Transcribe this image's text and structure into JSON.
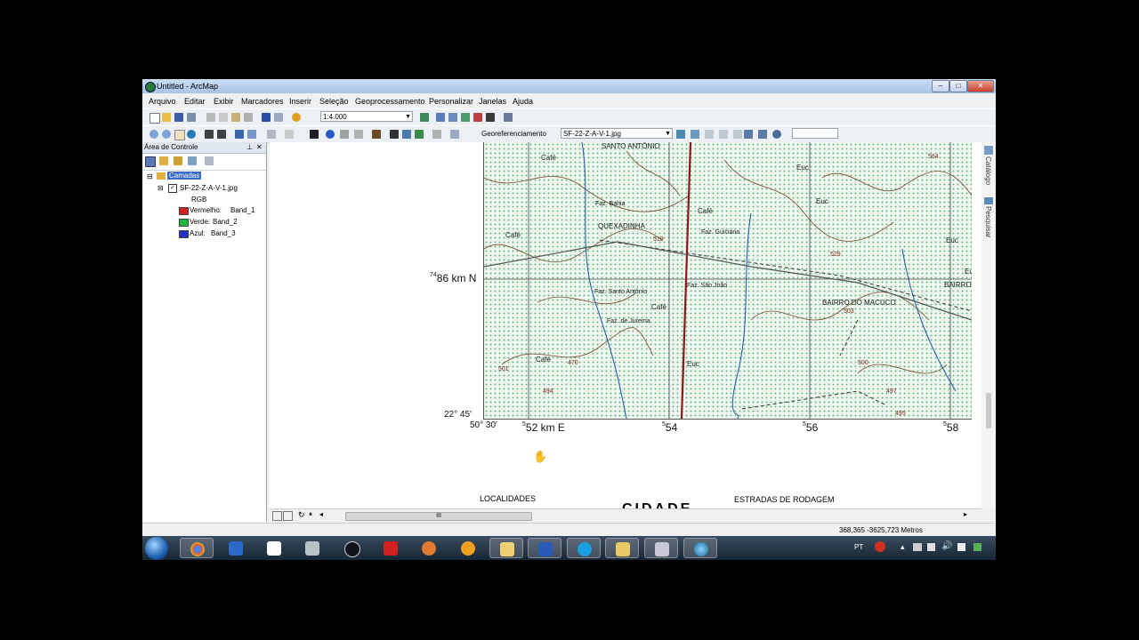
{
  "window": {
    "title": "Untitled - ArcMap",
    "minimize": "–",
    "maximize": "□",
    "close": "✕"
  },
  "menu": [
    "Arquivo",
    "Editar",
    "Exibir",
    "Marcadores",
    "Inserir",
    "Seleção",
    "Geoprocessamento",
    "Personalizar",
    "Janelas",
    "Ajuda"
  ],
  "toolbar": {
    "scale": "1:4.000",
    "georef_label": "Georeferenciamento",
    "georef_layer": "SF-22-Z-A-V-1.jpg"
  },
  "toc": {
    "title": "Área de Controle",
    "pin": "⊥",
    "close": "✕",
    "root": "Camadas",
    "layer": "SF-22-Z-A-V-1.jpg",
    "rgb": "RGB",
    "bands": [
      {
        "label": "Vermelho:",
        "band": "Band_1",
        "color": "#d42020"
      },
      {
        "label": "Verde:",
        "band": "Band_2",
        "color": "#20b83a"
      },
      {
        "label": "Azul:",
        "band": "Band_3",
        "color": "#2030c8"
      }
    ]
  },
  "sidetabs": {
    "catalog": "Catálogo",
    "search": "Pesquisar"
  },
  "map": {
    "labels": {
      "santo_antonio": "SANTO ANTÔNIO",
      "cafe1": "Café",
      "cafe2": "Café",
      "cafe3": "Café",
      "cafe4": "Café",
      "cafe5": "Café",
      "euc1": "Euc",
      "euc2": "Euc",
      "euc3": "Euc",
      "euc4": "Euc",
      "euc5": "Euc",
      "faz_bahia": "Faz. Bahia",
      "quexadinha": "QUEXADINHA",
      "faz_guiciana": "Faz. Guiciana",
      "faz_santo_antonio": "Faz. Santo Antônio",
      "faz_sao_joao": "Faz. São João",
      "bairro_macuco": "BAIRRO DO MACUCO",
      "bairro": "BAIRRO",
      "faz_jurema": "Faz. de Jurema",
      "elev_564": "564",
      "elev_529": "529",
      "elev_519": "519",
      "elev_470": "470",
      "elev_494": "494",
      "elev_497": "497",
      "elev_495": "495",
      "elev_500": "500",
      "elev_501": "501",
      "elev_503": "503"
    },
    "coords": {
      "north_small": "74",
      "north": "86 km N",
      "lat": "22° 45'",
      "lon": "50° 30'",
      "e1_small": "5",
      "e1": "52 km E",
      "e2_small": "5",
      "e2": "54",
      "e3_small": "5",
      "e3": "56",
      "e4_small": "5",
      "e4": "58"
    },
    "legend_localidades": "LOCALIDADES",
    "legend_estradas": "ESTRADAS DE RODAGEM",
    "legend_cidade": "CIDADE"
  },
  "hbar": {
    "scroll_thumb": "III"
  },
  "status": {
    "coordinates": "368,365  -3625,723 Metros"
  },
  "taskbar": {
    "lang": "PT"
  }
}
